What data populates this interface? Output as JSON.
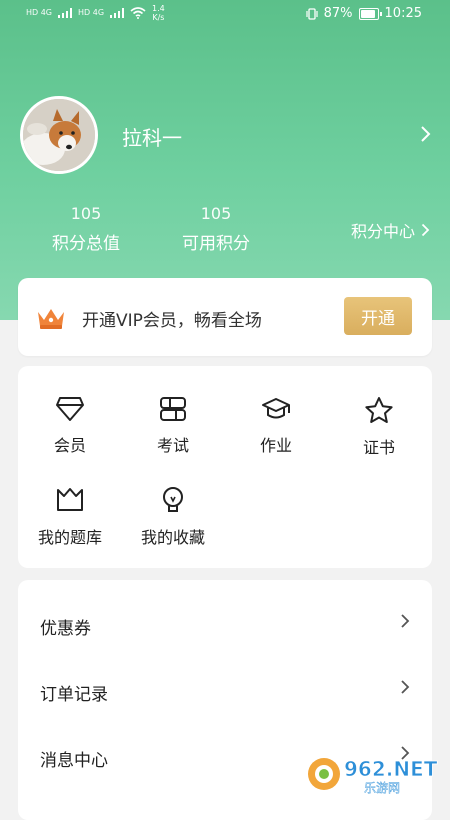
{
  "status_bar": {
    "sim1": "HD 4G",
    "sim2": "HD 4G",
    "speed_value": "1.4",
    "speed_unit": "K/s",
    "battery": "87%",
    "time": "10:25"
  },
  "profile": {
    "username": "拉科一",
    "avatar_icon": "dog-avatar-icon"
  },
  "stats": {
    "total_points_value": "105",
    "total_points_label": "积分总值",
    "available_points_value": "105",
    "available_points_label": "可用积分",
    "points_center_label": "积分中心"
  },
  "vip": {
    "text": "开通VIP会员，畅看全场",
    "button": "开通"
  },
  "grid": {
    "items": [
      {
        "label": "会员",
        "icon": "diamond-icon"
      },
      {
        "label": "考试",
        "icon": "exam-icon"
      },
      {
        "label": "作业",
        "icon": "graduation-cap-icon"
      },
      {
        "label": "证书",
        "icon": "star-icon"
      },
      {
        "label": "我的题库",
        "icon": "basket-icon"
      },
      {
        "label": "我的收藏",
        "icon": "bulb-icon"
      }
    ]
  },
  "list": {
    "items": [
      {
        "label": "优惠券"
      },
      {
        "label": "订单记录"
      },
      {
        "label": "消息中心"
      }
    ]
  },
  "watermark": {
    "text": "962.NET",
    "subtext": "乐游网"
  },
  "colors": {
    "header": "#5bc08a",
    "vip_button": "#dcb263",
    "crown": "#f0843a"
  }
}
